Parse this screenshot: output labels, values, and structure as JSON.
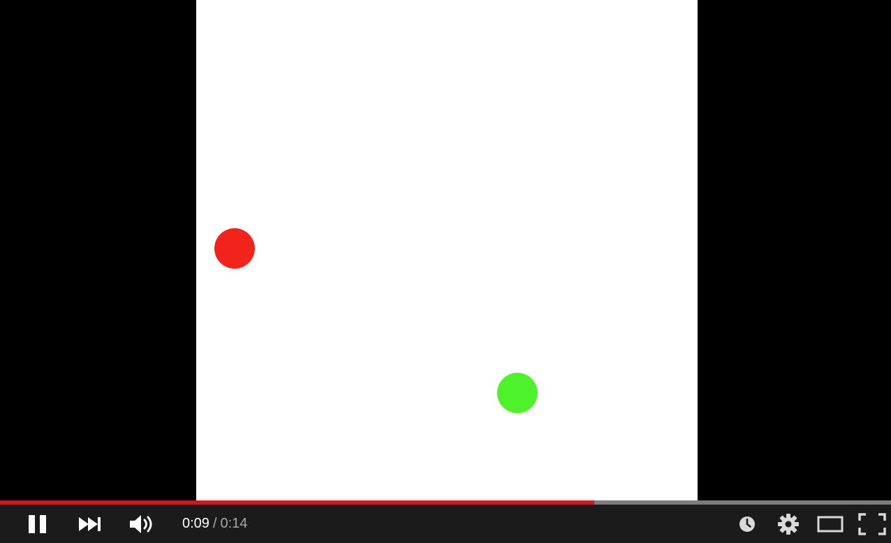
{
  "video": {
    "background_color": "#ffffff",
    "dots": [
      {
        "name": "red-dot",
        "color": "#f2231b"
      },
      {
        "name": "green-dot",
        "color": "#4ef22a"
      }
    ]
  },
  "progress": {
    "played_fraction": 0.6673,
    "played_color": "#cc181e",
    "track_color": "#7d7d7d"
  },
  "controls": {
    "play_state_icon": "pause-icon",
    "next_icon": "next-icon",
    "volume_icon": "volume-icon",
    "time": {
      "current": "0:09",
      "separator": "/",
      "duration": "0:14"
    },
    "right_icons": [
      "watch-later-icon",
      "settings-gear-icon",
      "theater-mode-icon",
      "fullscreen-icon"
    ]
  }
}
